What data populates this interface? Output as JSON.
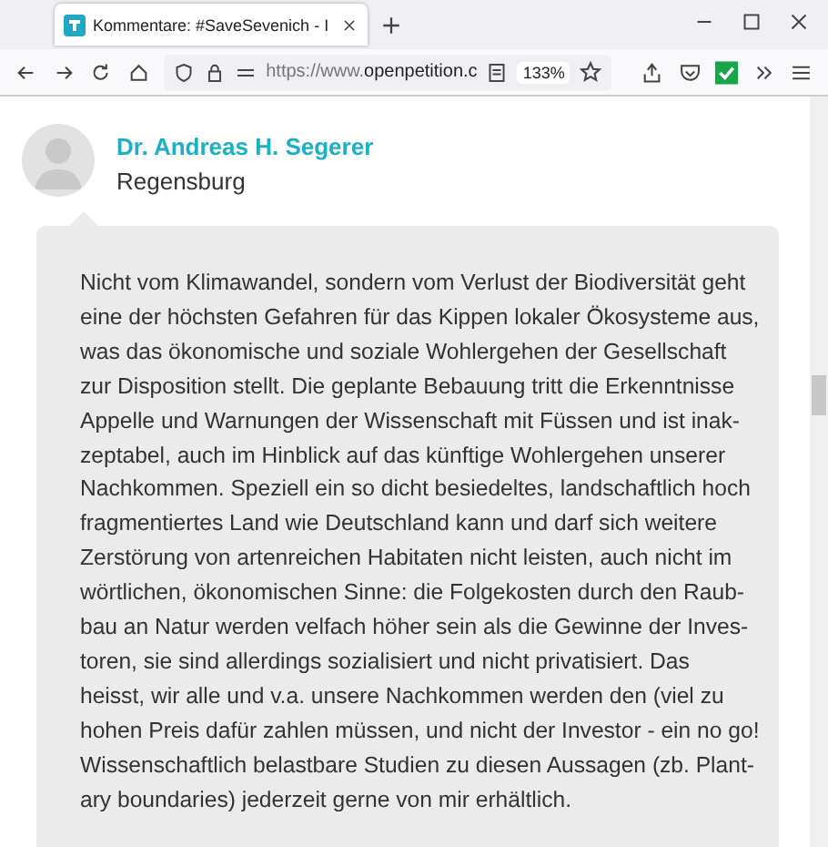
{
  "tab": {
    "title": "Kommentare: #SaveSevenich - I",
    "selected": true
  },
  "address_bar": {
    "url_prefix": "https://www.",
    "url_domain": "openpetition.c",
    "zoom": "133%"
  },
  "comment": {
    "author": "Dr. Andreas H. Segerer",
    "location": "Regensburg",
    "text_lines": [
      "Nicht vom Klimawandel, sondern vom Verlust der Biodiversität geht",
      "eine der höchsten Gefahren für das Kippen lokaler Ökosysteme aus,",
      "was das ökonomische und soziale Wohlergehen der Gesellschaft",
      "zur Disposition stellt. Die geplante Bebauung tritt die Erkenntnisse",
      "Appelle und Warnungen der Wissenschaft mit Füssen und ist inak-",
      "zeptabel, auch im Hinblick auf das künftige Wohlergehen unserer",
      "Nachkommen. Speziell ein so dicht besiedeltes, landschaftlich hoch",
      "fragmentiertes Land wie Deutschland kann und darf sich weitere",
      "Zerstörung von artenreichen Habitaten nicht leisten, auch nicht im",
      "wörtlichen, ökonomischen Sinne: die Folgekosten durch den Raub-",
      "bau an Natur werden velfach höher sein als die Gewinne der Inves-",
      "toren, sie sind allerdings sozialisiert und nicht privatisiert. Das",
      "heisst, wir alle und v.a. unsere Nachkommen werden den (viel zu",
      "hohen Preis dafür zahlen müssen, und nicht der Investor - ein no go!",
      "Wissenschaftlich belastbare Studien zu diesen Aussagen (zb. Plant-",
      "ary boundaries) jederzeit gerne von mir erhältlich."
    ]
  }
}
